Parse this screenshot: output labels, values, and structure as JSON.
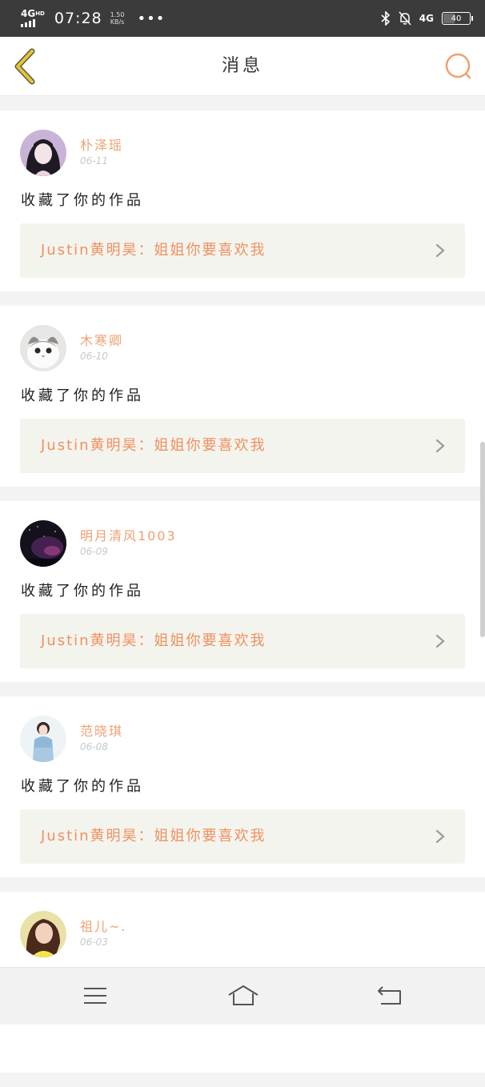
{
  "statusbar": {
    "network": "4G",
    "network_sup": "HD",
    "time": "07:28",
    "speed_value": "1.50",
    "speed_unit": "KB/s",
    "dots": "•••",
    "network2": "4G",
    "battery": "40"
  },
  "header": {
    "title": "消息"
  },
  "notifications": [
    {
      "name": "朴泽瑶",
      "date": "06-11",
      "action": "收藏了你的作品",
      "quote": "Justin黄明昊：姐姐你要喜欢我"
    },
    {
      "name": "木寒卿",
      "date": "06-10",
      "action": "收藏了你的作品",
      "quote": "Justin黄明昊：姐姐你要喜欢我"
    },
    {
      "name": "明月清风1003",
      "date": "06-09",
      "action": "收藏了你的作品",
      "quote": "Justin黄明昊：姐姐你要喜欢我"
    },
    {
      "name": "范晓琪",
      "date": "06-08",
      "action": "收藏了你的作品",
      "quote": "Justin黄明昊：姐姐你要喜欢我"
    },
    {
      "name": "祖儿~.",
      "date": "06-03",
      "action": "",
      "quote": ""
    }
  ],
  "colors": {
    "accent": "#f09060",
    "name": "#f0a070",
    "back_icon": "#e6c43a"
  },
  "icons": {
    "back": "chevron-left-icon",
    "search": "search-icon",
    "menu": "menu-icon",
    "home": "home-icon",
    "return": "return-icon"
  }
}
